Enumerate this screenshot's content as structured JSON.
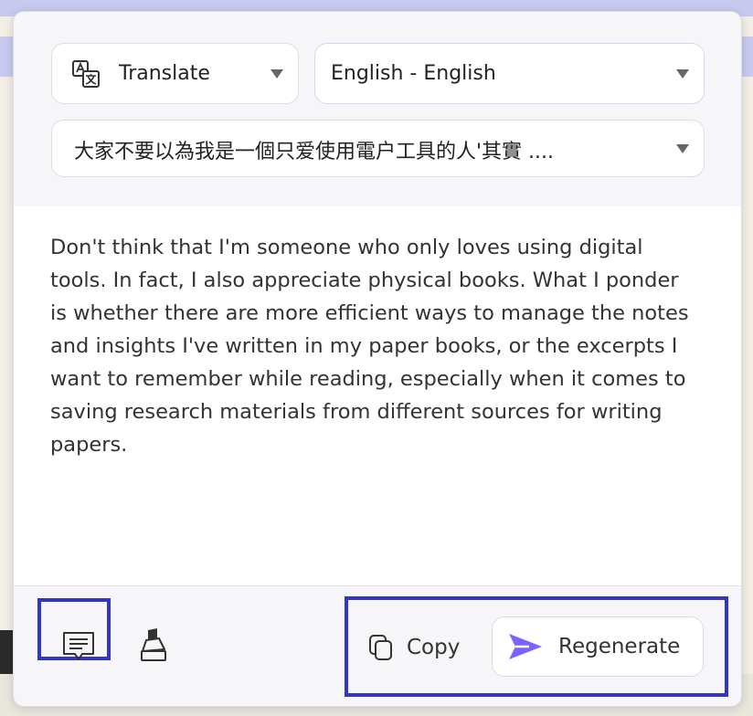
{
  "panel": {
    "mode_select": {
      "label": "Translate",
      "icon": "translate-icon"
    },
    "language_select": {
      "label": "English - English"
    },
    "source_select": {
      "label": "大家不要以為我是一個只爱使用電户工具的人'其實 ...."
    },
    "result_text": "Don't think that I'm someone who only loves using digital tools. In fact, I also appreciate physical books. What I ponder is whether there are more efficient ways to manage the notes and insights I've written in my paper books, or the excerpts I want to remember while reading, especially when it comes to saving research materials from different sources for writing papers.",
    "footer": {
      "note_icon": "note-icon",
      "highlighter_icon": "highlighter-icon",
      "copy_label": "Copy",
      "regenerate_label": "Regenerate"
    }
  },
  "colors": {
    "accent": "#7b61ff",
    "highlight_box": "#3136c6",
    "background_highlight": "#c8c9ef"
  }
}
